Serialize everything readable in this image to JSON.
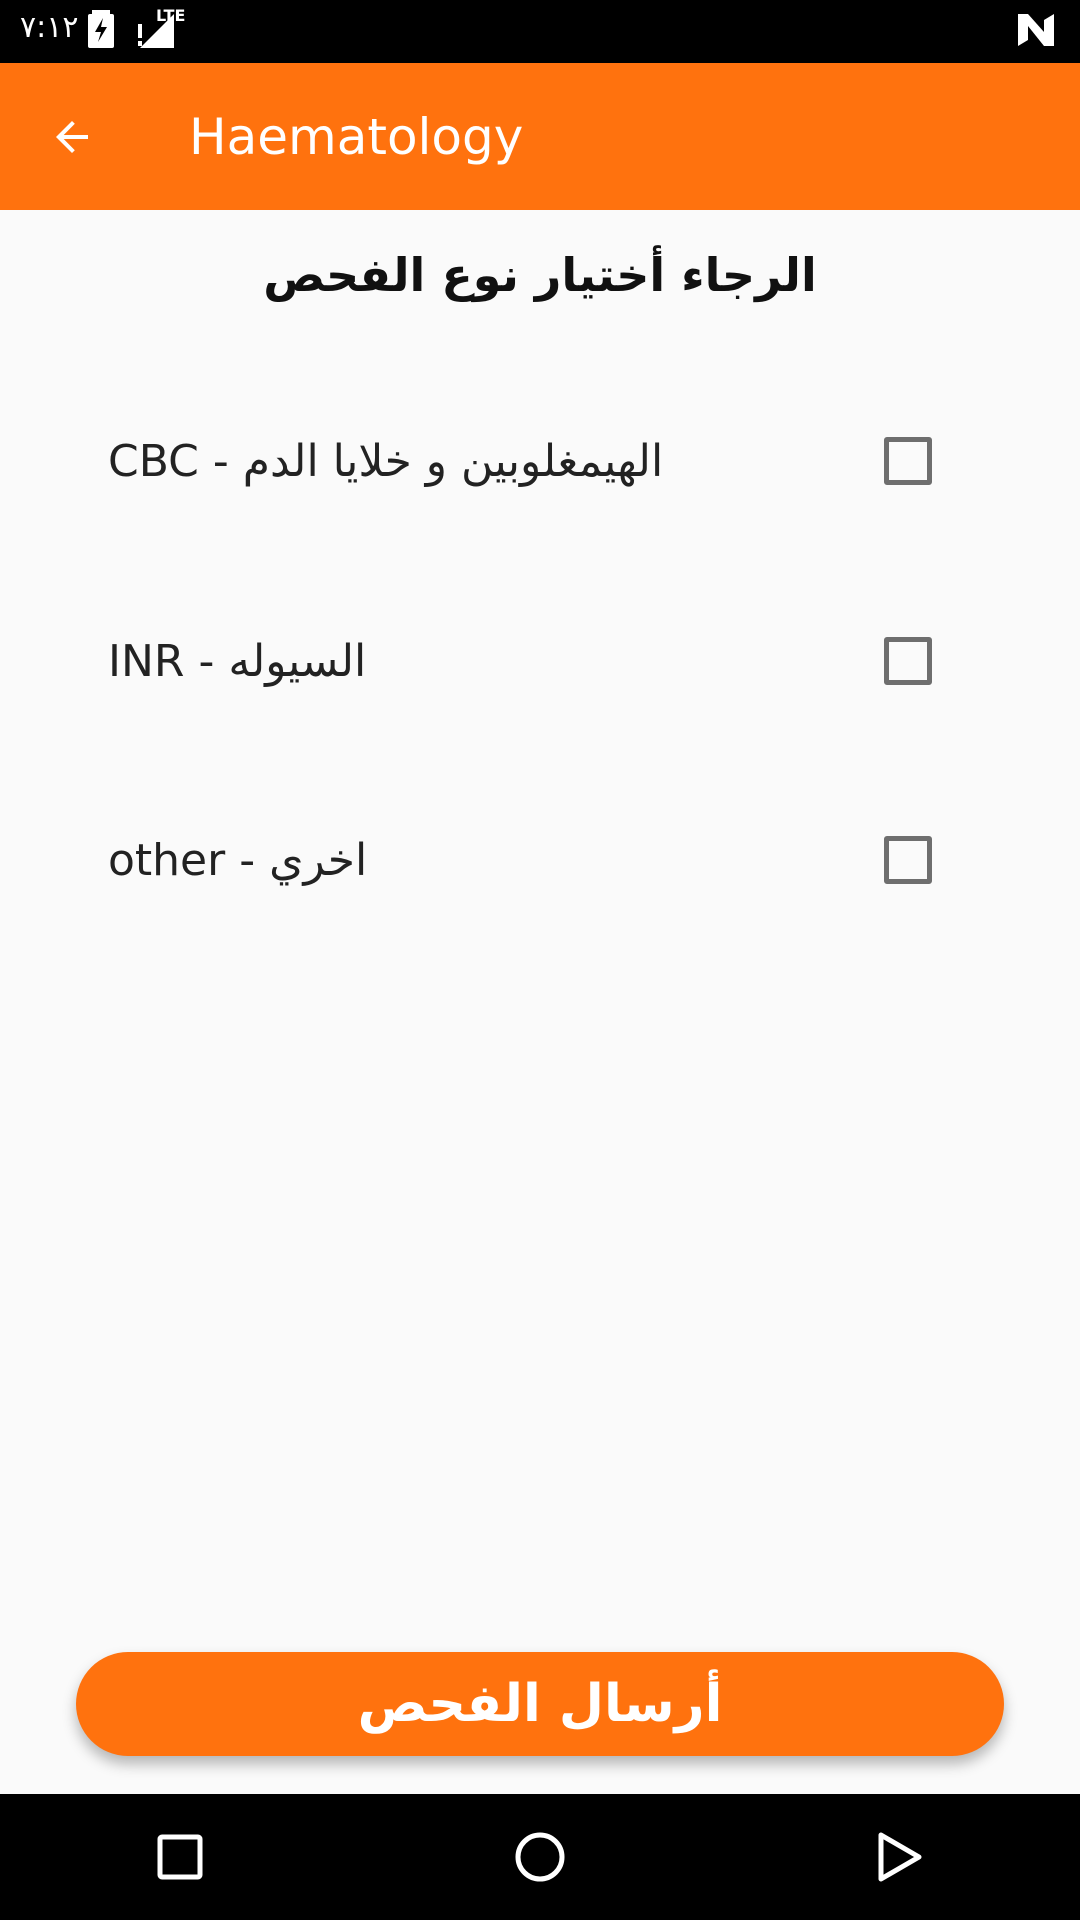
{
  "status_bar": {
    "time": "٧:١٢",
    "icons": [
      "battery-charging-icon",
      "signal-no-service-icon",
      "lte-icon",
      "notification-n-icon"
    ],
    "lte_label": "LTE"
  },
  "app_bar": {
    "title": "Haematology",
    "back_icon": "arrow-back-icon",
    "color": "#ff720e"
  },
  "main": {
    "heading": "الرجاء أختيار نوع الفحص",
    "options": [
      {
        "label": "CBC - الهيمغلوبين و خلايا الدم",
        "checked": false
      },
      {
        "label": "INR - السيوله",
        "checked": false
      },
      {
        "label": "other - اخري",
        "checked": false
      }
    ],
    "submit_label": "أرسال الفحص"
  },
  "nav_bar": {
    "buttons": [
      "recents-square-icon",
      "home-circle-icon",
      "back-triangle-icon"
    ]
  }
}
